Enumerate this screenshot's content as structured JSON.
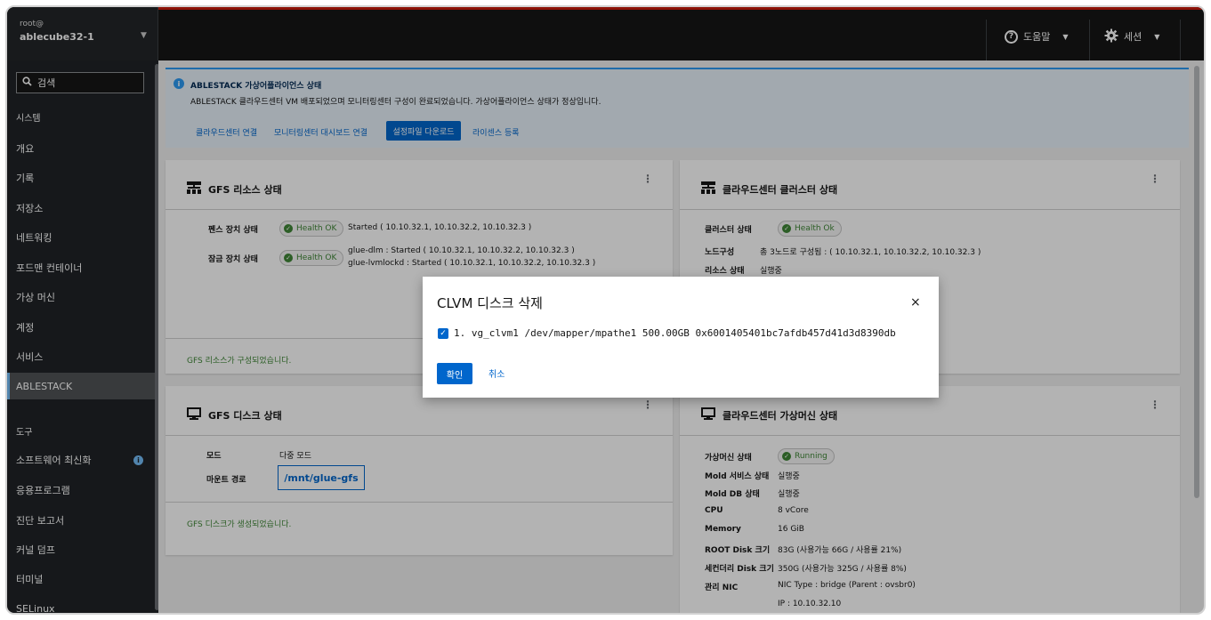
{
  "host": {
    "user": "root@",
    "name": "ablecube32-1"
  },
  "topbar": {
    "help_label": "도움말",
    "session_label": "세션"
  },
  "sidebar": {
    "search_label": "검색",
    "system_header": "시스템",
    "items": [
      "개요",
      "기록",
      "저장소",
      "네트워킹",
      "포드맨 컨테이너",
      "가상 머신",
      "계정",
      "서비스",
      "ABLESTACK"
    ],
    "tools_header": "도구",
    "tools": [
      "소프트웨어 최신화",
      "응용프로그램",
      "진단 보고서",
      "커널 덤프",
      "터미널",
      "SELinux"
    ],
    "active": "ABLESTACK"
  },
  "banner": {
    "title": "ABLESTACK 가상어플라이언스 상태",
    "description": "ABLESTACK 클라우드센터 VM 배포되었으며 모니터링센터 구성이 완료되었습니다. 가상어플라이언스 상태가 정상입니다.",
    "links": [
      "클라우드센터 연결",
      "모니터링센터 대시보드 연결",
      "설정파일 다운로드",
      "라이센스 등록"
    ]
  },
  "gfs_resource": {
    "title": "GFS 리소스 상태",
    "fence_label": "펜스 장치 상태",
    "fence_badge": "Health OK",
    "fence_value": "Started ( 10.10.32.1, 10.10.32.2, 10.10.32.3 )",
    "lock_label": "잠금 장치 상태",
    "lock_badge": "Health OK",
    "lock_value1": "glue-dlm : Started ( 10.10.32.1, 10.10.32.2, 10.10.32.3 )",
    "lock_value2": "glue-lvmlockd : Started ( 10.10.32.1, 10.10.32.2, 10.10.32.3 )",
    "footer": "GFS 리소스가 구성되었습니다."
  },
  "cloud_cluster": {
    "title": "클라우드센터 클러스터 상태",
    "cluster_label": "클러스터 상태",
    "cluster_badge": "Health Ok",
    "node_label": "노드구성",
    "node_value": "총 3노드로 구성됨 : ( 10.10.32.1, 10.10.32.2, 10.10.32.3 )",
    "resource_label": "리소스 상태",
    "resource_value": "실행중"
  },
  "gfs_disk": {
    "title": "GFS 디스크 상태",
    "mode_label": "모드",
    "mode_value": "다중 모드",
    "mount_label": "마운트 경로",
    "mount_value": "/mnt/glue-gfs",
    "footer": "GFS 디스크가 생성되었습니다."
  },
  "cloud_vm": {
    "title": "클라우드센터 가상머신 상태",
    "rows": [
      {
        "label": "가상머신 상태",
        "value": "Running"
      },
      {
        "label": "Mold 서비스 상태",
        "value": "실행중"
      },
      {
        "label": "Mold DB 상태",
        "value": "실행중"
      },
      {
        "label": "CPU",
        "value": "8 vCore"
      },
      {
        "label": "Memory",
        "value": "16 GiB"
      },
      {
        "label": "ROOT Disk 크기",
        "value": "83G (사용가능 66G / 사용률 21%)"
      },
      {
        "label": "세컨더리 Disk 크기",
        "value": "350G (사용가능 325G / 사용률 8%)"
      },
      {
        "label": "관리 NIC",
        "value": "NIC Type : bridge (Parent : ovsbr0)"
      }
    ],
    "nic_ip": "IP : 10.10.32.10"
  },
  "modal": {
    "title": "CLVM 디스크 삭제",
    "close": "×",
    "item": "1. vg_clvm1 /dev/mapper/mpathe1 500.00GB 0x6001405401bc7afdb457d41d3d8390db",
    "item_checked": true,
    "ok_label": "확인",
    "cancel_label": "취소"
  },
  "colors": {
    "accent": "#0066cc",
    "success": "#3e8635",
    "topbar": "#151515",
    "sidebar": "#1f2226",
    "alert_red": "#c9190b"
  }
}
